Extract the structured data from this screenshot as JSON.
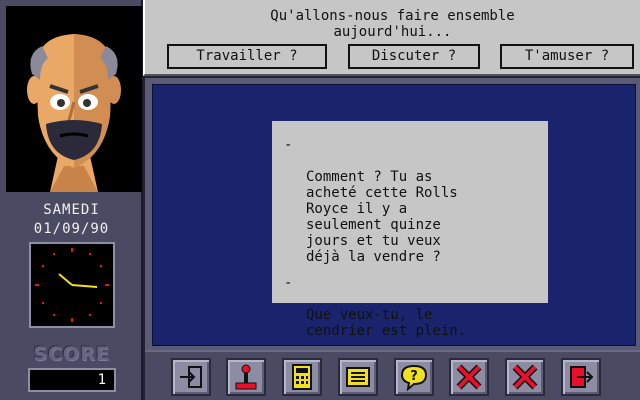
{
  "question": {
    "text": "Qu'allons-nous faire ensemble\naujourd'hui...",
    "choices": [
      "Travailler ?",
      "Discuter ?",
      "T'amuser ?"
    ]
  },
  "status": {
    "day": "SAMEDI",
    "date": "01/09/90",
    "score_label": "SCORE",
    "score": "1"
  },
  "dialogue": {
    "lines": [
      "Comment ? Tu as\nacheté cette Rolls\nRoyce il y a\nseulement quinze\njours et tu veux\ndéjà la vendre ?",
      "Que veux-tu, le\ncendrier est plein."
    ],
    "bullet": "-"
  },
  "toolbar": {
    "icons": [
      "enter-icon",
      "joystick-icon",
      "calculator-icon",
      "notepad-icon",
      "help-icon",
      "cancel-icon",
      "cancel-icon",
      "exit-icon"
    ]
  },
  "colors": {
    "panel_gray": "#c6c6c6",
    "dialogue_blue": "#1a246c",
    "frame": "#4a4a62",
    "icon_red": "#e8102a",
    "icon_yellow": "#f0e020"
  }
}
